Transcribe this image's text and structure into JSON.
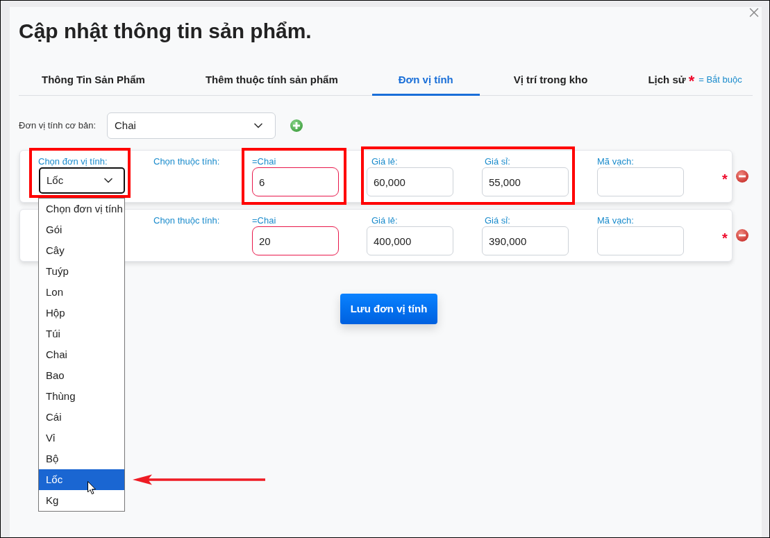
{
  "dialog": {
    "title": "Cập nhật thông tin sản phẩm."
  },
  "tabs": [
    {
      "label": "Thông Tin Sản Phẩm",
      "selected": false
    },
    {
      "label": "Thêm thuộc tính sản phẩm",
      "selected": false
    },
    {
      "label": "Đơn vị tính",
      "selected": true
    },
    {
      "label": "Vị trí trong kho",
      "selected": false
    },
    {
      "label": "Lịch sử",
      "selected": false
    }
  ],
  "required_legend": {
    "mark": "*",
    "text": "= Bắt buộc"
  },
  "base_unit": {
    "label": "Đơn vị tính cơ bản:",
    "value": "Chai"
  },
  "unit_rows": [
    {
      "unit": {
        "label": "Chọn đơn vị tính:",
        "value": "Lốc",
        "open": true,
        "highlighted": true,
        "arrow": true,
        "options": [
          {
            "label": "Chọn đơn vị tính",
            "selected": false
          },
          {
            "label": "Gói",
            "selected": false
          },
          {
            "label": "Cây",
            "selected": false
          },
          {
            "label": "Tuýp",
            "selected": false
          },
          {
            "label": "Lon",
            "selected": false
          },
          {
            "label": "Hộp",
            "selected": false
          },
          {
            "label": "Túi",
            "selected": false
          },
          {
            "label": "Chai",
            "selected": false
          },
          {
            "label": "Bao",
            "selected": false
          },
          {
            "label": "Thùng",
            "selected": false
          },
          {
            "label": "Cái",
            "selected": false
          },
          {
            "label": "Vỉ",
            "selected": false
          },
          {
            "label": "Bộ",
            "selected": false
          },
          {
            "label": "Lốc",
            "selected": true
          },
          {
            "label": "Kg",
            "selected": false
          }
        ]
      },
      "attribute_label": "Chọn thuộc tính:",
      "ratio": {
        "label": "=Chai",
        "value": "6",
        "invalid": true,
        "highlighted": true
      },
      "prices": {
        "highlighted": true,
        "retail": {
          "label": "Giá lẻ:",
          "value": "60,000"
        },
        "wholesale": {
          "label": "Giá sỉ:",
          "value": "55,000"
        }
      },
      "barcode": {
        "label": "Mã vạch:"
      },
      "required_mark": "*"
    },
    {
      "attribute_label": "Chọn thuộc tính:",
      "ratio": {
        "label": "=Chai",
        "value": "20",
        "invalid": true,
        "highlighted": false
      },
      "prices": {
        "highlighted": false,
        "retail": {
          "label": "Giá lẻ:",
          "value": "400,000"
        },
        "wholesale": {
          "label": "Giá sỉ:",
          "value": "390,000"
        }
      },
      "barcode": {
        "label": "Mã vạch:"
      },
      "required_mark": "*"
    }
  ],
  "save_button": "Lưu đơn vị tính"
}
